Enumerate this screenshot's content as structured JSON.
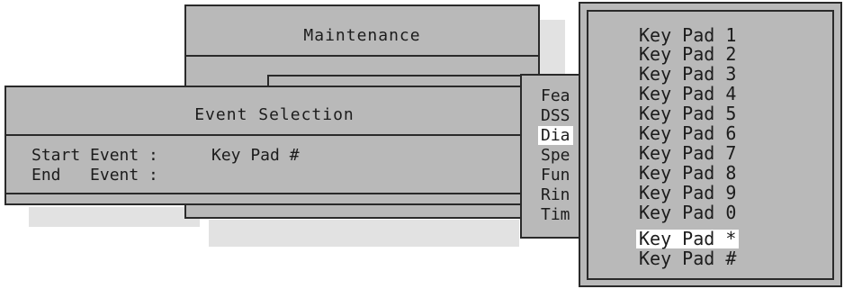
{
  "maintenance": {
    "title": "Maintenance"
  },
  "event_selection": {
    "title": "Event Selection",
    "start_label": "Start Event :",
    "start_value": "Key Pad #",
    "end_label": "End   Event :",
    "end_value": ""
  },
  "feature_menu": {
    "items": [
      "Fea",
      "DSS",
      "Dia",
      "Spe",
      "Fun",
      "Rin",
      "Tim"
    ],
    "selected_index": 2
  },
  "keypad_menu": {
    "items": [
      "Key Pad 1",
      "Key Pad 2",
      "Key Pad 3",
      "Key Pad 4",
      "Key Pad 5",
      "Key Pad 6",
      "Key Pad 7",
      "Key Pad 8",
      "Key Pad 9",
      "Key Pad 0",
      "Key Pad *",
      "Key Pad #"
    ],
    "selected_index": 10
  }
}
